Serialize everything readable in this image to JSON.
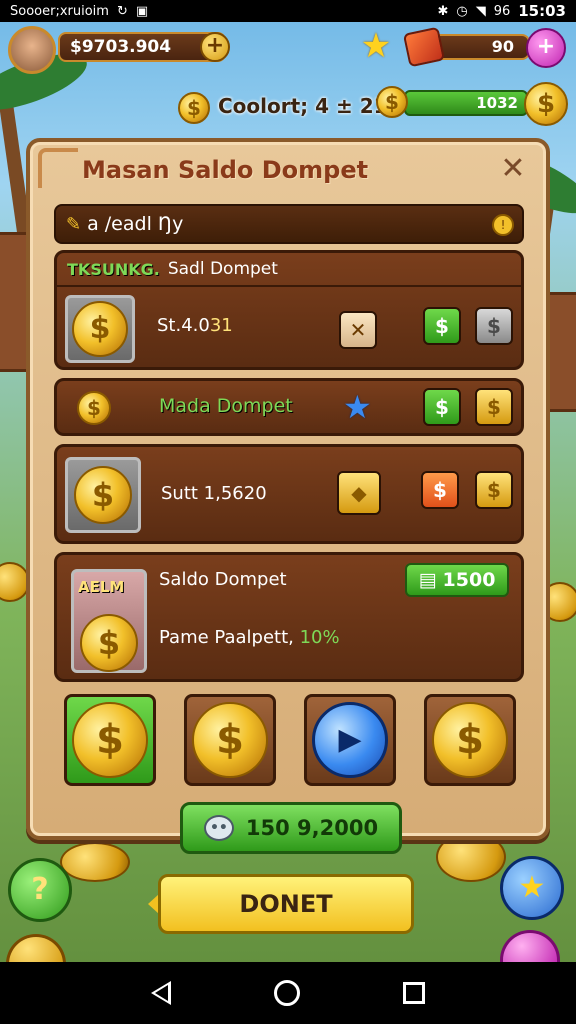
{
  "status_bar": {
    "carrier": "Soooer;xruioim",
    "time": "15:03",
    "battery": "96"
  },
  "hud": {
    "balance": "$9703.904",
    "plus": "+",
    "gems": "90",
    "pink_button": "+",
    "coupon": "Coolort; 4 ± 21",
    "xp_value": "1032"
  },
  "panel": {
    "title": "Masan Saldo Dompet",
    "close": "✕",
    "search_text": "a /eadl Ŋy",
    "rows": [
      {
        "tag": "TKSUNKG.",
        "title": "Sadl Dompet",
        "value": "St.4.0",
        "value_highlight": "31",
        "btn_mid": "✕",
        "btn_a": "$",
        "btn_b": "$"
      },
      {
        "label": "Mada Dompet",
        "btn_a": "$",
        "btn_b": "$"
      },
      {
        "value": "Sutt 1,5620",
        "btn_a": "$",
        "btn_b": "$"
      },
      {
        "badge": "AELM",
        "title": "Saldo Dompet",
        "green_value": "1500",
        "subtitle": "Pame Paalpett,",
        "percent": "10%"
      }
    ],
    "total": "150 9,2000",
    "chat_icon_text": "••"
  },
  "actions": {
    "donate": "DONET",
    "left_round": "?",
    "right_round": "★"
  },
  "colors": {
    "panel_bg": "#e8c89a",
    "row_bg": "#7a3e1c",
    "accent_green": "#2f9a1a",
    "accent_gold": "#f2c02a",
    "accent_blue": "#3a8af0"
  }
}
